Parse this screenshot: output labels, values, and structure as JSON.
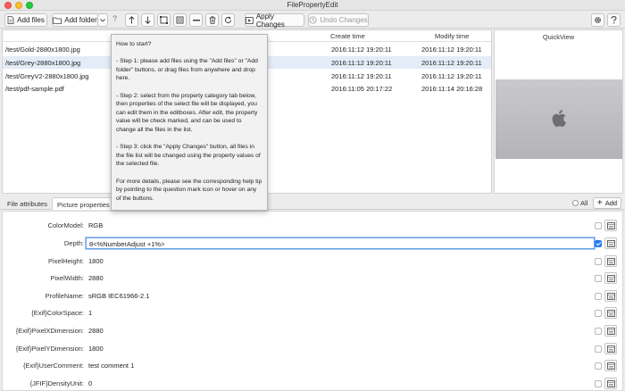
{
  "window": {
    "title": "FilePropertyEdit"
  },
  "toolbar": {
    "add_files": "Add files",
    "add_folder": "Add folder",
    "help": "?",
    "apply_changes": "Apply Changes",
    "undo_changes": "Undo Changes"
  },
  "file_list": {
    "col_created": "Create time",
    "col_modified": "Modify time",
    "rows": [
      {
        "path": "/test/Gold-2880x1800.jpg",
        "created": "2016:11:12 19:20:11",
        "modified": "2016:11:12 19:20:11",
        "selected": false
      },
      {
        "path": "/test/Grey-2880x1800.jpg",
        "created": "2016:11:12 19:20:11",
        "modified": "2016:11:12 19:20:11",
        "selected": true
      },
      {
        "path": "/test/GreyV2-2880x1800.jpg",
        "created": "2016:11:12 19:20:11",
        "modified": "2016:11:12 19:20:11",
        "selected": false
      },
      {
        "path": "/test/pdf-sample.pdf",
        "created": "2016:11:05 20:17:22",
        "modified": "2016:11:14 20:16:28",
        "selected": false
      }
    ]
  },
  "quickview": {
    "title": "QuickView"
  },
  "tabs": {
    "file_attributes": "File attributes",
    "picture_properties": "Picture properties",
    "all_label": "All",
    "add_label": "Add"
  },
  "properties": [
    {
      "name": "ColorModel:",
      "value": "RGB",
      "checked": false,
      "editing": false
    },
    {
      "name": "Depth:",
      "value": "8<%NumberAdjust +1%>",
      "checked": true,
      "editing": true
    },
    {
      "name": "PixelHeight:",
      "value": "1800",
      "checked": false,
      "editing": false
    },
    {
      "name": "PixelWidth:",
      "value": "2880",
      "checked": false,
      "editing": false
    },
    {
      "name": "ProfileName:",
      "value": "sRGB IEC61966-2.1",
      "checked": false,
      "editing": false
    },
    {
      "name": "{Exif}ColorSpace:",
      "value": "1",
      "checked": false,
      "editing": false
    },
    {
      "name": "{Exif}PixelXDimension:",
      "value": "2880",
      "checked": false,
      "editing": false
    },
    {
      "name": "{Exif}PixelYDimension:",
      "value": "1800",
      "checked": false,
      "editing": false
    },
    {
      "name": "{Exif}UserComment:",
      "value": "test comment 1",
      "checked": false,
      "editing": false
    },
    {
      "name": "{JFIF}DensityUnit:",
      "value": "0",
      "checked": false,
      "editing": false
    }
  ],
  "help_tooltip": {
    "heading": "How to start?",
    "step1": "- Step 1: please add files using the \"Add files\" or \"Add folder\" buttons, or drag files from anywhere and drop here.",
    "step2": "- Step 2: select from the property category tab below, then properties of the select file will be displayed, you can edit them in the editboxes. After edit, the property value will be check marked, and can be used to change all the files in the list.",
    "step3": "- Step 3: click the \"Apply Changes\" button, all files in the file list will be changed using the property values of the selected file.",
    "more": "For more details, please see the corresponding help tip by pointing to the question mark icon or hover on any of the buttons."
  },
  "colors": {
    "selection": "#e4ecf7",
    "checkbox_on": "#2a7bf0",
    "focus_ring": "#6aa0e8"
  }
}
